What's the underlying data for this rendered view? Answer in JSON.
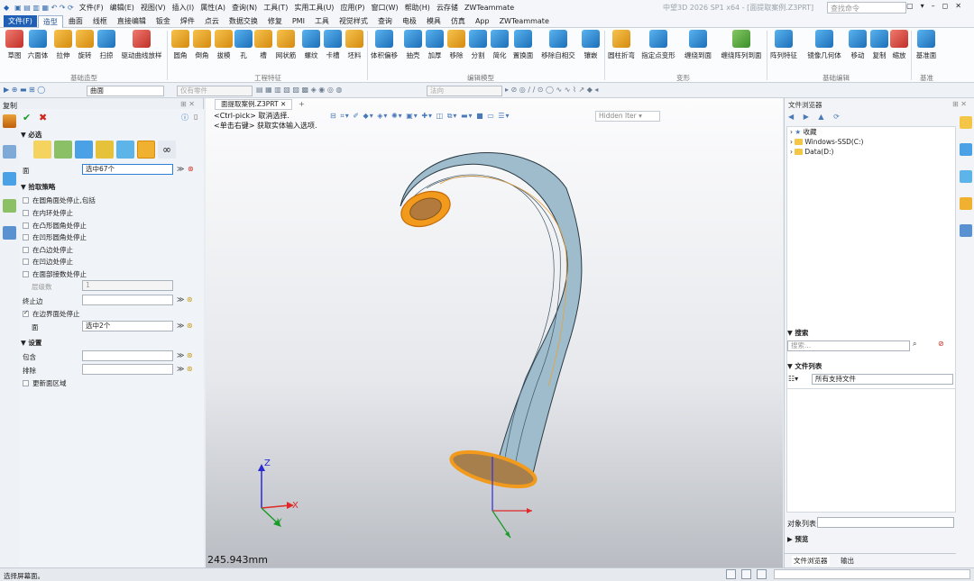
{
  "app": {
    "title": "中望3D 2026 SP1 x64 - [面提取案例.Z3PRT]",
    "menus": [
      "文件(F)",
      "编辑(E)",
      "视图(V)",
      "插入(I)",
      "属性(A)",
      "查询(N)",
      "工具(T)",
      "实用工具(U)",
      "应用(P)",
      "窗口(W)",
      "帮助(H)",
      "云存储",
      "ZWTeammate"
    ],
    "search_placeholder": "查找命令"
  },
  "tabs": [
    "文件(F)",
    "造型",
    "曲面",
    "线框",
    "直接编辑",
    "钣金",
    "焊件",
    "点云",
    "数据交换",
    "修复",
    "PMI",
    "工具",
    "视觉样式",
    "查询",
    "电极",
    "模具",
    "仿真",
    "App",
    "ZWTeammate"
  ],
  "ribbon": {
    "groups": [
      {
        "label": "基础造型"
      },
      {
        "label": "工程特征"
      },
      {
        "label": "编辑模型"
      },
      {
        "label": "变形"
      },
      {
        "label": "基础编辑"
      },
      {
        "label": "基准"
      }
    ],
    "buttons": [
      "草图",
      "六面体",
      "拉伸",
      "旋转",
      "扫掠",
      "驱动曲线放样",
      "圆角",
      "倒角",
      "拔模",
      "孔",
      "槽",
      "网状筋",
      "螺纹",
      "卡槽",
      "坯料",
      "体积偏移",
      "抽壳",
      "加厚",
      "移除",
      "分割",
      "简化",
      "置换面",
      "移除自相交",
      "镶嵌",
      "圆柱折弯",
      "指定点变形",
      "缠绕到面",
      "缠绕阵列到面",
      "阵列特征",
      "镜像几何体",
      "移动",
      "复制",
      "缩放",
      "基准面"
    ]
  },
  "quickbar": {
    "filter": "曲面",
    "part_scope": "仅有零件",
    "direction": "法向"
  },
  "left": {
    "title": "复制",
    "required": "必选",
    "face_label": "面",
    "face_value": "选中67个",
    "pick_strategy": "拾取策略",
    "options": [
      "在圆角面处停止,包括",
      "在内环处停止",
      "在凸形圆角处停止",
      "在凹形圆角处停止",
      "在凸边处停止",
      "在凹边处停止",
      "在面部接数处停止"
    ],
    "layers_label": "层级数",
    "layers_value": "1",
    "end_edge_label": "终止边",
    "boundary_stop": "在边界面处停止",
    "face2_label": "面",
    "face2_value": "选中2个",
    "settings": "设置",
    "include_label": "包含",
    "exclude_label": "排除",
    "update_region": "更新面区域"
  },
  "viewport": {
    "tab": "面提取案例.Z3PRT",
    "hint1": "<Ctrl-pick> 取消选择.",
    "hint2": "<单击右键> 获取实体输入选项.",
    "render_mode": "Hidden lter",
    "scale": "245.943mm",
    "axes": [
      "X",
      "Y",
      "Z"
    ]
  },
  "right": {
    "title": "文件浏览器",
    "tree": [
      "收藏",
      "Windows-SSD(C:)",
      "Data(D:)"
    ],
    "search_label": "搜索",
    "search_placeholder": "搜索...",
    "file_list_label": "文件列表",
    "file_type": "所有支持文件",
    "object_list_label": "对象列表",
    "preview_label": "预览",
    "bottom_tabs": [
      "文件浏览器",
      "输出"
    ]
  },
  "status": "选择屏幕面。"
}
